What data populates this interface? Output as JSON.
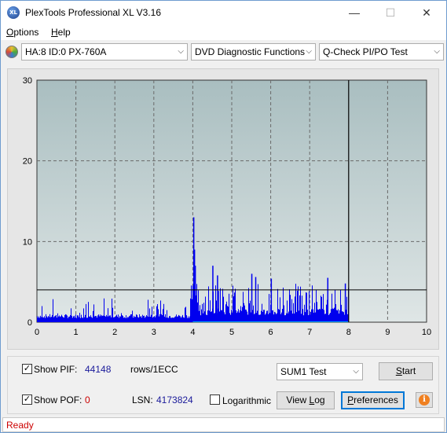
{
  "window": {
    "title": "PlexTools Professional XL V3.16",
    "app_icon_text": "XL",
    "minimize": "—",
    "maximize": "☐",
    "close": "✕"
  },
  "menu": {
    "options_u": "O",
    "options_rest": "ptions",
    "help_u": "H",
    "help_rest": "elp"
  },
  "toolbar": {
    "drive": "HA:8 ID:0  PX-760A",
    "function": "DVD Diagnostic Functions",
    "test": "Q-Check PI/PO Test",
    "arrow": "⌵"
  },
  "chart_data": {
    "type": "bar",
    "x_ticks": [
      "0",
      "1",
      "2",
      "3",
      "4",
      "5",
      "6",
      "7",
      "8",
      "9",
      "10"
    ],
    "y_ticks": [
      "0",
      "10",
      "20",
      "30"
    ],
    "xlim": [
      0,
      10
    ],
    "ylim": [
      0,
      30
    ],
    "threshold": 4,
    "data_end_x": 8,
    "grid": true,
    "plot_bg": "#b5c7c9",
    "bar_color": "#0000ee",
    "po_color": "#00aaee",
    "segments": [
      {
        "x_start": 0.0,
        "x_end": 3.95,
        "base": 1,
        "spike_max": 3,
        "spike_density": 0.12
      },
      {
        "x_start": 3.95,
        "x_end": 4.05,
        "base": 3,
        "spike_max": 7,
        "spike_density": 0.5
      },
      {
        "x_start": 4.05,
        "x_end": 8.0,
        "base": 1.7,
        "spike_max": 4.8,
        "spike_density": 0.35
      }
    ],
    "spikes": [
      {
        "x": 4.01,
        "y": 13
      },
      {
        "x": 4.03,
        "y": 9
      },
      {
        "x": 4.05,
        "y": 7
      },
      {
        "x": 4.5,
        "y": 7
      },
      {
        "x": 4.62,
        "y": 5.8
      },
      {
        "x": 5.5,
        "y": 6
      },
      {
        "x": 5.6,
        "y": 5.6
      },
      {
        "x": 6.0,
        "y": 5.4
      },
      {
        "x": 7.45,
        "y": 5.5
      },
      {
        "x": 7.9,
        "y": 4.8
      }
    ]
  },
  "panel": {
    "show_pif_label": "Show PIF:",
    "pif_value": "44148",
    "rows_label": "rows/1ECC",
    "show_pof_label": "Show POF:",
    "pof_value": "0",
    "lsn_label": "LSN:",
    "lsn_value": "4173824",
    "logarithmic_label": "Logarithmic",
    "sum_test": "SUM1 Test",
    "start_u": "S",
    "start_rest": "tart",
    "viewlog_pre": "View ",
    "viewlog_u": "L",
    "viewlog_rest": "og",
    "prefs_u": "P",
    "prefs_rest": "references",
    "check_mark": "✓",
    "info_icon": "i"
  },
  "status": {
    "text": "Ready"
  }
}
